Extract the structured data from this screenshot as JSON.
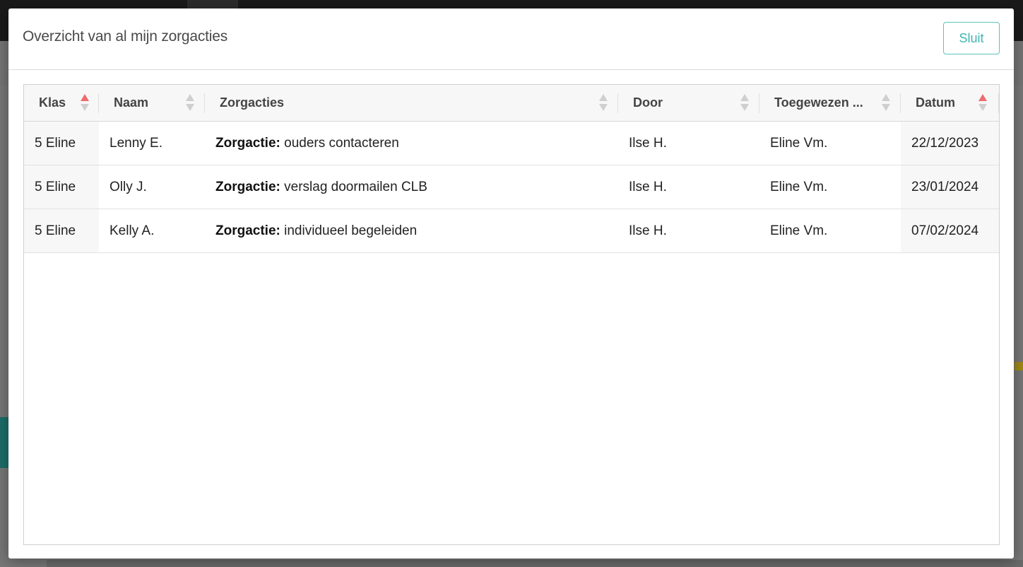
{
  "modal": {
    "title": "Overzicht van al mijn zorgacties",
    "close_label": "Sluit"
  },
  "table": {
    "columns": [
      {
        "label": "Klas",
        "sort": "asc"
      },
      {
        "label": "Naam",
        "sort": "none"
      },
      {
        "label": "Zorgacties",
        "sort": "none"
      },
      {
        "label": "Door",
        "sort": "none"
      },
      {
        "label": "Toegewezen ...",
        "sort": "none"
      },
      {
        "label": "Datum",
        "sort": "asc"
      }
    ],
    "rows": [
      {
        "klas": "5 Eline",
        "naam": "Lenny E.",
        "zorg_prefix": "Zorgactie:",
        "zorg_text": " ouders contacteren",
        "door": "Ilse H.",
        "toegewezen": "Eline Vm.",
        "datum": "22/12/2023"
      },
      {
        "klas": "5 Eline",
        "naam": "Olly J.",
        "zorg_prefix": "Zorgactie:",
        "zorg_text": " verslag doormailen CLB",
        "door": "Ilse H.",
        "toegewezen": "Eline Vm.",
        "datum": "23/01/2024"
      },
      {
        "klas": "5 Eline",
        "naam": "Kelly A.",
        "zorg_prefix": "Zorgactie:",
        "zorg_text": " individueel begeleiden",
        "door": "Ilse H.",
        "toegewezen": "Eline Vm.",
        "datum": "07/02/2024"
      }
    ]
  },
  "colors": {
    "accent": "#3fb6b0",
    "sort_active": "#f06b6b",
    "sort_inactive": "#cfcfcf"
  }
}
